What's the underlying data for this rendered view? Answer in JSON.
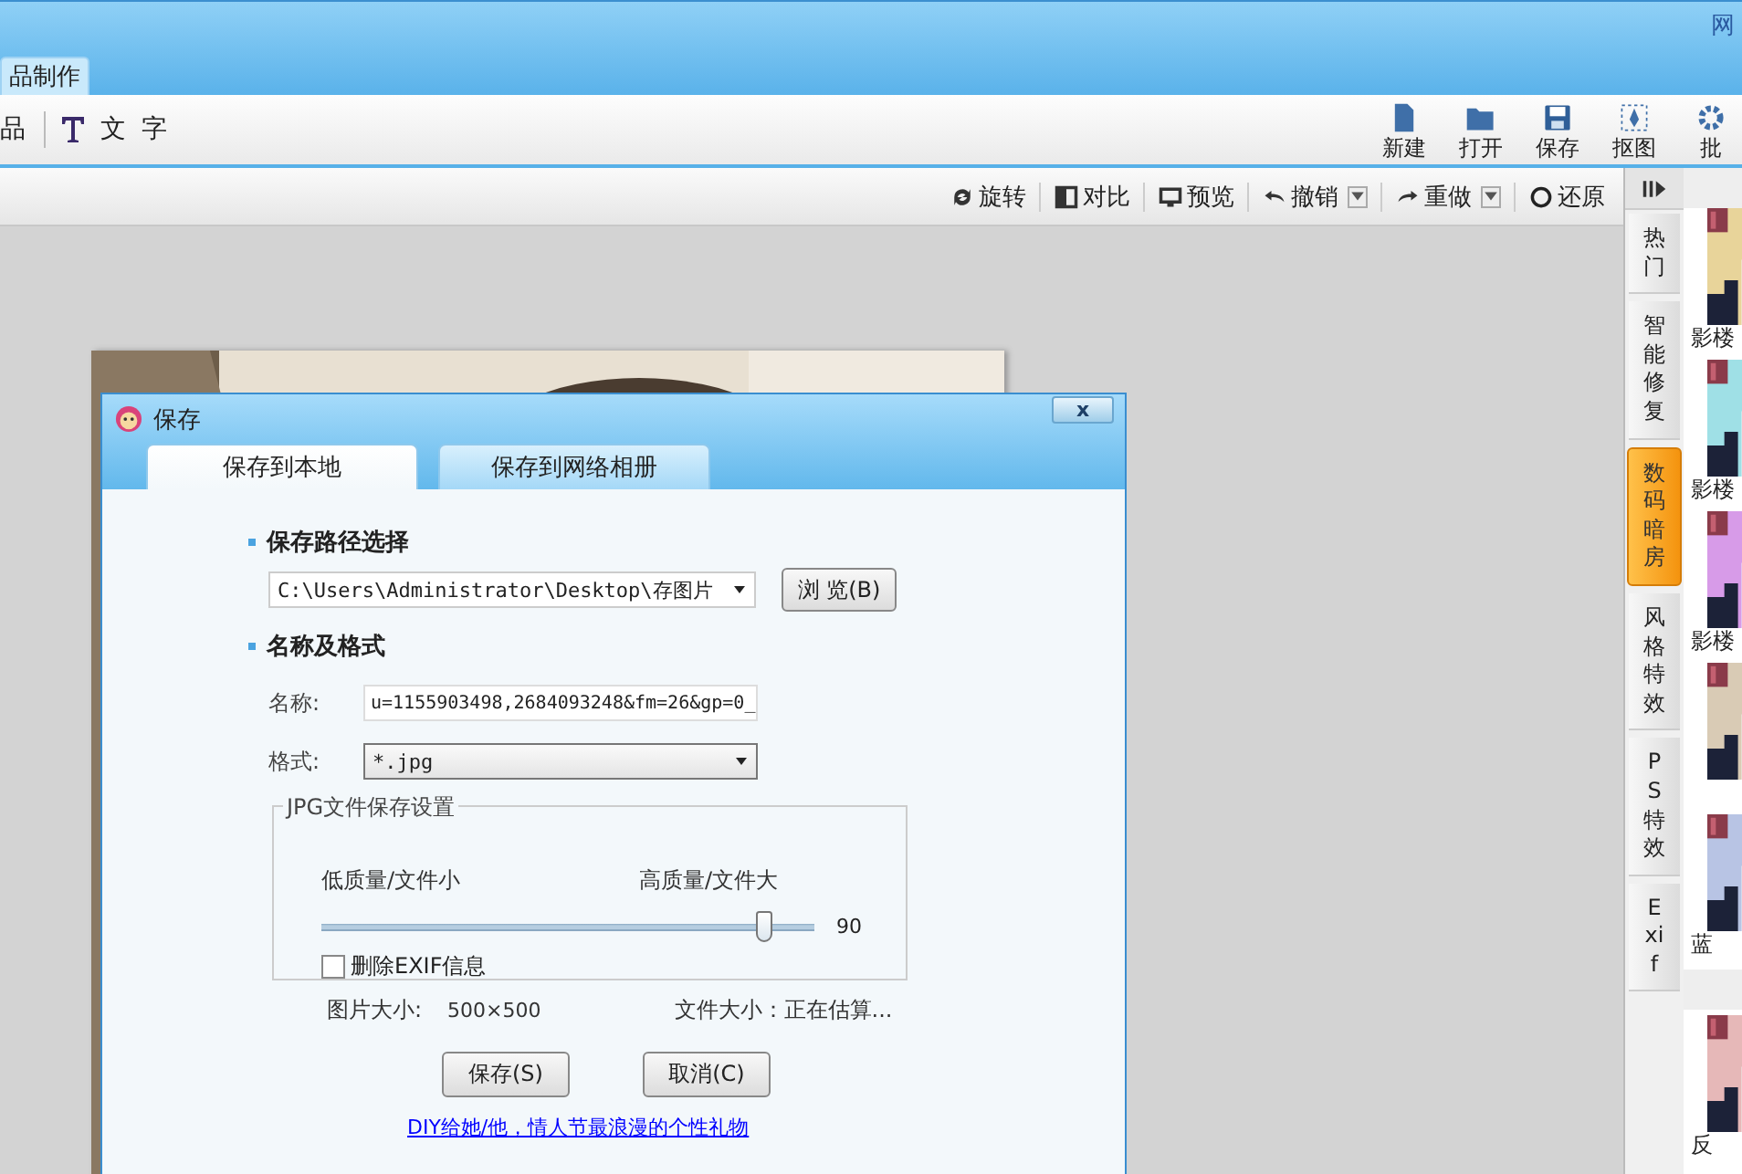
{
  "top_bar": {
    "site_text": "网"
  },
  "app_tabs": [
    {
      "label": "品制作",
      "selected": true
    }
  ],
  "main_toolbar": {
    "left": [
      {
        "label": "品",
        "kind": "plain"
      },
      {
        "label": "文 字",
        "kind": "text"
      }
    ],
    "right": [
      {
        "label": "新建",
        "kind": "new"
      },
      {
        "label": "打开",
        "kind": "open"
      },
      {
        "label": "保存",
        "kind": "save"
      },
      {
        "label": "抠图",
        "kind": "cutout"
      },
      {
        "label": "批",
        "kind": "batch"
      }
    ]
  },
  "edit_toolbar": [
    {
      "label": "旋转",
      "kind": "rotate",
      "dropdown": false
    },
    {
      "label": "对比",
      "kind": "compare",
      "dropdown": false
    },
    {
      "label": "预览",
      "kind": "preview",
      "dropdown": false
    },
    {
      "label": "撤销",
      "kind": "undo",
      "dropdown": true
    },
    {
      "label": "重做",
      "kind": "redo",
      "dropdown": true
    },
    {
      "label": "还原",
      "kind": "restore",
      "dropdown": false
    }
  ],
  "canvas": {
    "photo": {
      "kind": "picture"
    }
  },
  "dialog": {
    "title": "保存",
    "close": "x",
    "tabs": [
      {
        "label": "保存到本地",
        "selected": true
      },
      {
        "label": "保存到网络相册",
        "selected": false
      }
    ],
    "path_section": {
      "heading": "保存路径选择",
      "path": "C:\\Users\\Administrator\\Desktop\\存图片",
      "browse": "浏 览(B)"
    },
    "name_section": {
      "heading": "名称及格式",
      "name_label": "名称:",
      "name_value": "u=1155903498,2684093248&fm=26&gp=0_",
      "format_label": "格式:",
      "format_value": "*.jpg"
    },
    "jpg_group": {
      "legend": "JPG文件保存设置",
      "low_label": "低质量/文件小",
      "high_label": "高质量/文件大",
      "quality": {
        "level": 0.9,
        "reading": "90"
      },
      "remove_exif": {
        "label": "删除EXIF信息",
        "checked": false
      }
    },
    "image_size_label": "图片大小:",
    "image_size": "500×500",
    "file_size": "文件大小：正在估算...",
    "buttons": [
      {
        "label": "保存(S)"
      },
      {
        "label": "取消(C)"
      }
    ],
    "link": "DIY给她/他，情人节最浪漫的个性礼物"
  },
  "side_panel": {
    "tabs": [
      {
        "label": "热门",
        "selected": false
      },
      {
        "label": "智能修复",
        "selected": false
      },
      {
        "label": "数码暗房",
        "selected": true
      },
      {
        "label": "风格特效",
        "selected": false
      },
      {
        "label": "PS特效",
        "selected": false
      },
      {
        "label": "Exif",
        "selected": false
      }
    ],
    "thumbnails": [
      {
        "kind": "picture",
        "label": "影楼"
      },
      {
        "kind": "picture",
        "label": "影楼"
      },
      {
        "kind": "picture",
        "label": "影楼"
      },
      {
        "kind": "picture"
      },
      {
        "kind": "picture",
        "label": "蓝"
      },
      {
        "kind": "picture",
        "label": "反"
      }
    ]
  }
}
